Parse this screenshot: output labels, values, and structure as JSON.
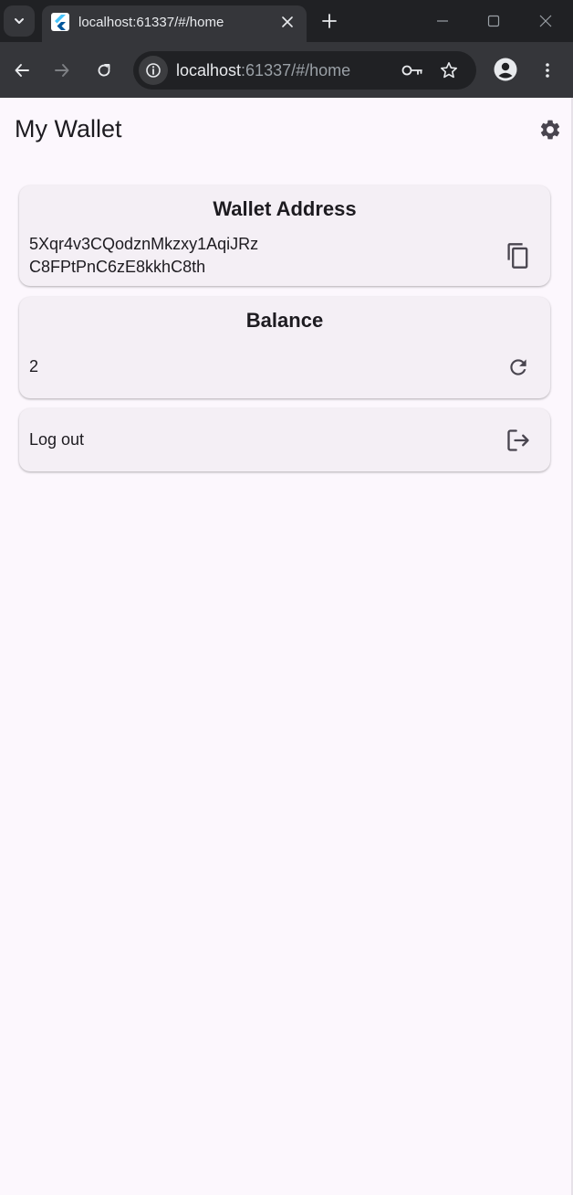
{
  "browser": {
    "tab_title": "localhost:61337/#/home",
    "url_host": "localhost",
    "url_rest": ":61337/#/home"
  },
  "app": {
    "title": "My Wallet"
  },
  "wallet_card": {
    "title": "Wallet Address",
    "address_line1": "5Xqr4v3CQodznMkzxy1AqiJRz",
    "address_line2": "C8FPtPnC6zE8kkhC8th"
  },
  "balance_card": {
    "title": "Balance",
    "value": "2"
  },
  "logout_card": {
    "label": "Log out"
  },
  "icons": {
    "tab_search": "chevron-down-icon",
    "favicon": "flutter-icon",
    "settings": "gear-icon",
    "copy": "copy-icon",
    "refresh": "refresh-icon",
    "logout": "logout-icon"
  }
}
